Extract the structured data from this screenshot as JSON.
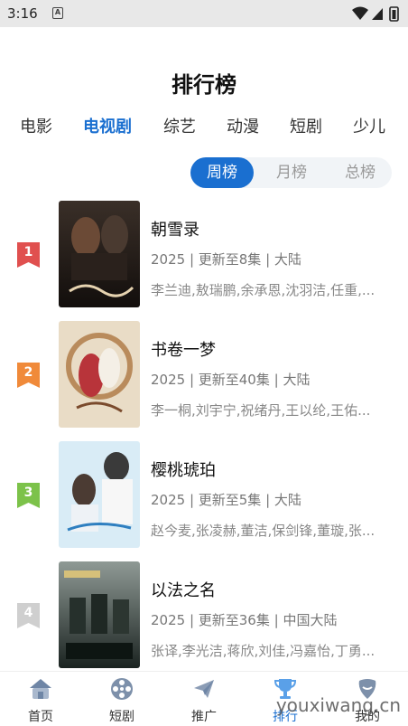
{
  "status_bar": {
    "time": "3:16",
    "notif_letter": "A"
  },
  "title": "排行榜",
  "categories": [
    "电影",
    "电视剧",
    "综艺",
    "动漫",
    "短剧",
    "少儿"
  ],
  "active_category": "电视剧",
  "periods": [
    "周榜",
    "月榜",
    "总榜"
  ],
  "active_period": "周榜",
  "rankings": [
    {
      "rank": "1",
      "title": "朝雪录",
      "meta": "2025 | 更新至8集 | 大陆",
      "cast": "李兰迪,敖瑞鹏,余承恩,沈羽洁,任重,...",
      "badge_color": "#e0504f",
      "poster_theme": "dark-warm"
    },
    {
      "rank": "2",
      "title": "书卷一梦",
      "meta": "2025 | 更新至40集 | 大陆",
      "cast": "李一桐,刘宇宁,祝绪丹,王以纶,王佑...",
      "badge_color": "#f08a3a",
      "poster_theme": "cream-red"
    },
    {
      "rank": "3",
      "title": "樱桃琥珀",
      "meta": "2025 | 更新至5集 | 大陆",
      "cast": "赵今麦,张凌赫,董洁,保剑锋,董璇,张...",
      "badge_color": "#7cc24a",
      "poster_theme": "light-blue"
    },
    {
      "rank": "4",
      "title": "以法之名",
      "meta": "2025 | 更新至36集 | 中国大陆",
      "cast": "张译,李光洁,蒋欣,刘佳,冯嘉怡,丁勇...",
      "badge_color": "#cfcfcf",
      "poster_theme": "dark-teal"
    }
  ],
  "nav": [
    {
      "label": "首页",
      "icon": "home-icon"
    },
    {
      "label": "短剧",
      "icon": "film-reel-icon"
    },
    {
      "label": "推广",
      "icon": "paper-plane-icon"
    },
    {
      "label": "排行",
      "icon": "trophy-icon"
    },
    {
      "label": "我的",
      "icon": "profile-icon"
    }
  ],
  "active_nav": "排行",
  "watermark": "youxiwang.cn",
  "colors": {
    "accent": "#1a6fd0"
  }
}
